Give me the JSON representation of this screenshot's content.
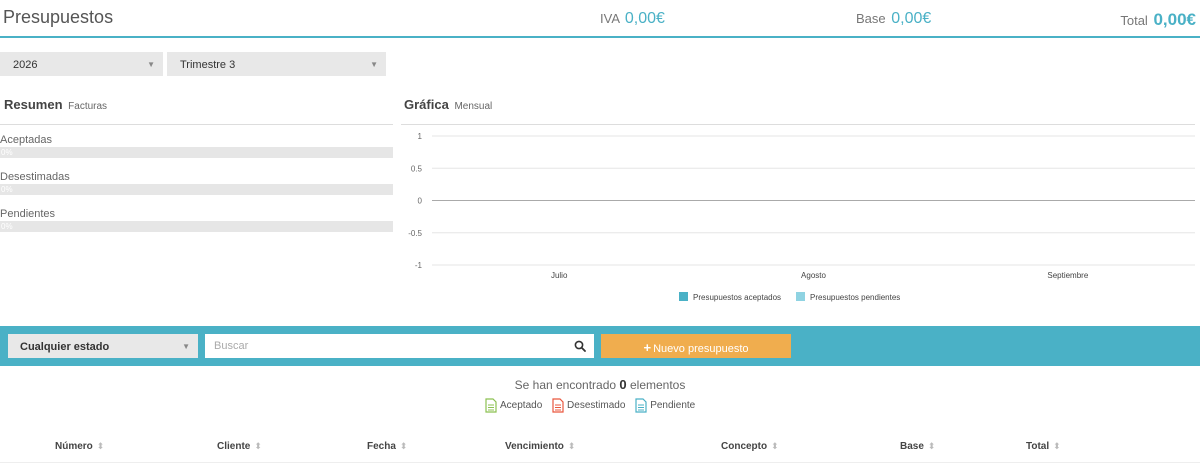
{
  "header": {
    "title": "Presupuestos",
    "iva_label": "IVA",
    "iva_value": "0,00€",
    "base_label": "Base",
    "base_value": "0,00€",
    "total_label": "Total",
    "total_value": "0,00€"
  },
  "filters": {
    "year": "2026",
    "quarter": "Trimestre 3"
  },
  "resumen": {
    "title": "Resumen",
    "subtitle": "Facturas",
    "items": [
      {
        "label": "Aceptadas",
        "pct_text": "0%",
        "pct": 0
      },
      {
        "label": "Desestimadas",
        "pct_text": "0%",
        "pct": 0
      },
      {
        "label": "Pendientes",
        "pct_text": "0%",
        "pct": 0
      }
    ]
  },
  "grafica": {
    "title": "Gráfica",
    "subtitle": "Mensual"
  },
  "chart_data": {
    "type": "bar",
    "categories": [
      "Julio",
      "Agosto",
      "Septiembre"
    ],
    "series": [
      {
        "name": "Presupuestos aceptados",
        "values": [
          0,
          0,
          0
        ],
        "color": "#4ab1c6"
      },
      {
        "name": "Presupuestos pendientes",
        "values": [
          0,
          0,
          0
        ],
        "color": "#8fd3e2"
      }
    ],
    "ylim": [
      -1,
      1
    ],
    "yticks": [
      "1",
      "0.5",
      "0",
      "-0.5",
      "-1"
    ],
    "grid": true,
    "legend": "bottom"
  },
  "toolbar": {
    "estado": "Cualquier estado",
    "search_placeholder": "Buscar",
    "new_button": "Nuevo presupuesto",
    "accent": "#4ab1c6",
    "button_color": "#f0ad4e"
  },
  "results": {
    "prefix": "Se han encontrado",
    "count": "0",
    "suffix": "elementos",
    "legend": [
      {
        "label": "Aceptado",
        "color": "#8cc152",
        "icon": "document-icon"
      },
      {
        "label": "Desestimado",
        "color": "#e9573f",
        "icon": "document-icon"
      },
      {
        "label": "Pendiente",
        "color": "#4ab1c6",
        "icon": "document-icon"
      }
    ]
  },
  "table": {
    "columns": [
      "Número",
      "Cliente",
      "Fecha",
      "Vencimiento",
      "Concepto",
      "Base",
      "Total"
    ]
  }
}
